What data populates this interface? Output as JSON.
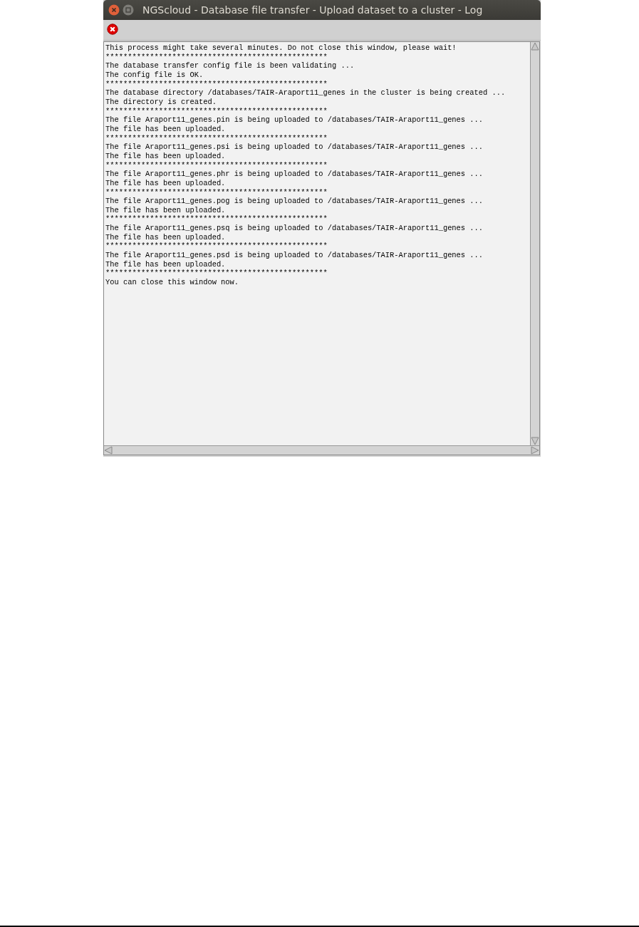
{
  "window": {
    "title": "NGScloud - Database file transfer - Upload dataset to a cluster - Log"
  },
  "log": {
    "lines": [
      "This process might take several minutes. Do not close this window, please wait!",
      "**************************************************",
      "The database transfer config file is been validating ...",
      "The config file is OK.",
      "**************************************************",
      "The database directory /databases/TAIR-Araport11_genes in the cluster is being created ...",
      "The directory is created.",
      "**************************************************",
      "The file Araport11_genes.pin is being uploaded to /databases/TAIR-Araport11_genes ...",
      "The file has been uploaded.",
      "**************************************************",
      "The file Araport11_genes.psi is being uploaded to /databases/TAIR-Araport11_genes ...",
      "The file has been uploaded.",
      "**************************************************",
      "The file Araport11_genes.phr is being uploaded to /databases/TAIR-Araport11_genes ...",
      "The file has been uploaded.",
      "**************************************************",
      "The file Araport11_genes.pog is being uploaded to /databases/TAIR-Araport11_genes ...",
      "The file has been uploaded.",
      "**************************************************",
      "The file Araport11_genes.psq is being uploaded to /databases/TAIR-Araport11_genes ...",
      "The file has been uploaded.",
      "**************************************************",
      "The file Araport11_genes.psd is being uploaded to /databases/TAIR-Araport11_genes ...",
      "The file has been uploaded.",
      "**************************************************",
      "You can close this window now."
    ]
  }
}
